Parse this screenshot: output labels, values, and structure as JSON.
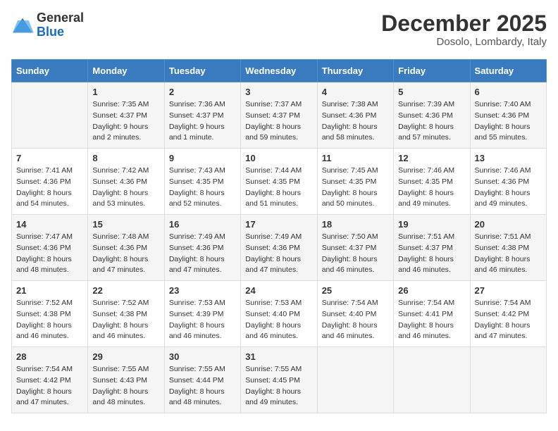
{
  "logo": {
    "general": "General",
    "blue": "Blue"
  },
  "header": {
    "month": "December 2025",
    "location": "Dosolo, Lombardy, Italy"
  },
  "days_of_week": [
    "Sunday",
    "Monday",
    "Tuesday",
    "Wednesday",
    "Thursday",
    "Friday",
    "Saturday"
  ],
  "weeks": [
    [
      {
        "day": null,
        "info": null
      },
      {
        "day": "1",
        "info": "Sunrise: 7:35 AM\nSunset: 4:37 PM\nDaylight: 9 hours\nand 2 minutes."
      },
      {
        "day": "2",
        "info": "Sunrise: 7:36 AM\nSunset: 4:37 PM\nDaylight: 9 hours\nand 1 minute."
      },
      {
        "day": "3",
        "info": "Sunrise: 7:37 AM\nSunset: 4:37 PM\nDaylight: 8 hours\nand 59 minutes."
      },
      {
        "day": "4",
        "info": "Sunrise: 7:38 AM\nSunset: 4:36 PM\nDaylight: 8 hours\nand 58 minutes."
      },
      {
        "day": "5",
        "info": "Sunrise: 7:39 AM\nSunset: 4:36 PM\nDaylight: 8 hours\nand 57 minutes."
      },
      {
        "day": "6",
        "info": "Sunrise: 7:40 AM\nSunset: 4:36 PM\nDaylight: 8 hours\nand 55 minutes."
      }
    ],
    [
      {
        "day": "7",
        "info": "Sunrise: 7:41 AM\nSunset: 4:36 PM\nDaylight: 8 hours\nand 54 minutes."
      },
      {
        "day": "8",
        "info": "Sunrise: 7:42 AM\nSunset: 4:36 PM\nDaylight: 8 hours\nand 53 minutes."
      },
      {
        "day": "9",
        "info": "Sunrise: 7:43 AM\nSunset: 4:35 PM\nDaylight: 8 hours\nand 52 minutes."
      },
      {
        "day": "10",
        "info": "Sunrise: 7:44 AM\nSunset: 4:35 PM\nDaylight: 8 hours\nand 51 minutes."
      },
      {
        "day": "11",
        "info": "Sunrise: 7:45 AM\nSunset: 4:35 PM\nDaylight: 8 hours\nand 50 minutes."
      },
      {
        "day": "12",
        "info": "Sunrise: 7:46 AM\nSunset: 4:35 PM\nDaylight: 8 hours\nand 49 minutes."
      },
      {
        "day": "13",
        "info": "Sunrise: 7:46 AM\nSunset: 4:36 PM\nDaylight: 8 hours\nand 49 minutes."
      }
    ],
    [
      {
        "day": "14",
        "info": "Sunrise: 7:47 AM\nSunset: 4:36 PM\nDaylight: 8 hours\nand 48 minutes."
      },
      {
        "day": "15",
        "info": "Sunrise: 7:48 AM\nSunset: 4:36 PM\nDaylight: 8 hours\nand 47 minutes."
      },
      {
        "day": "16",
        "info": "Sunrise: 7:49 AM\nSunset: 4:36 PM\nDaylight: 8 hours\nand 47 minutes."
      },
      {
        "day": "17",
        "info": "Sunrise: 7:49 AM\nSunset: 4:36 PM\nDaylight: 8 hours\nand 47 minutes."
      },
      {
        "day": "18",
        "info": "Sunrise: 7:50 AM\nSunset: 4:37 PM\nDaylight: 8 hours\nand 46 minutes."
      },
      {
        "day": "19",
        "info": "Sunrise: 7:51 AM\nSunset: 4:37 PM\nDaylight: 8 hours\nand 46 minutes."
      },
      {
        "day": "20",
        "info": "Sunrise: 7:51 AM\nSunset: 4:38 PM\nDaylight: 8 hours\nand 46 minutes."
      }
    ],
    [
      {
        "day": "21",
        "info": "Sunrise: 7:52 AM\nSunset: 4:38 PM\nDaylight: 8 hours\nand 46 minutes."
      },
      {
        "day": "22",
        "info": "Sunrise: 7:52 AM\nSunset: 4:38 PM\nDaylight: 8 hours\nand 46 minutes."
      },
      {
        "day": "23",
        "info": "Sunrise: 7:53 AM\nSunset: 4:39 PM\nDaylight: 8 hours\nand 46 minutes."
      },
      {
        "day": "24",
        "info": "Sunrise: 7:53 AM\nSunset: 4:40 PM\nDaylight: 8 hours\nand 46 minutes."
      },
      {
        "day": "25",
        "info": "Sunrise: 7:54 AM\nSunset: 4:40 PM\nDaylight: 8 hours\nand 46 minutes."
      },
      {
        "day": "26",
        "info": "Sunrise: 7:54 AM\nSunset: 4:41 PM\nDaylight: 8 hours\nand 46 minutes."
      },
      {
        "day": "27",
        "info": "Sunrise: 7:54 AM\nSunset: 4:42 PM\nDaylight: 8 hours\nand 47 minutes."
      }
    ],
    [
      {
        "day": "28",
        "info": "Sunrise: 7:54 AM\nSunset: 4:42 PM\nDaylight: 8 hours\nand 47 minutes."
      },
      {
        "day": "29",
        "info": "Sunrise: 7:55 AM\nSunset: 4:43 PM\nDaylight: 8 hours\nand 48 minutes."
      },
      {
        "day": "30",
        "info": "Sunrise: 7:55 AM\nSunset: 4:44 PM\nDaylight: 8 hours\nand 48 minutes."
      },
      {
        "day": "31",
        "info": "Sunrise: 7:55 AM\nSunset: 4:45 PM\nDaylight: 8 hours\nand 49 minutes."
      },
      {
        "day": null,
        "info": null
      },
      {
        "day": null,
        "info": null
      },
      {
        "day": null,
        "info": null
      }
    ]
  ]
}
